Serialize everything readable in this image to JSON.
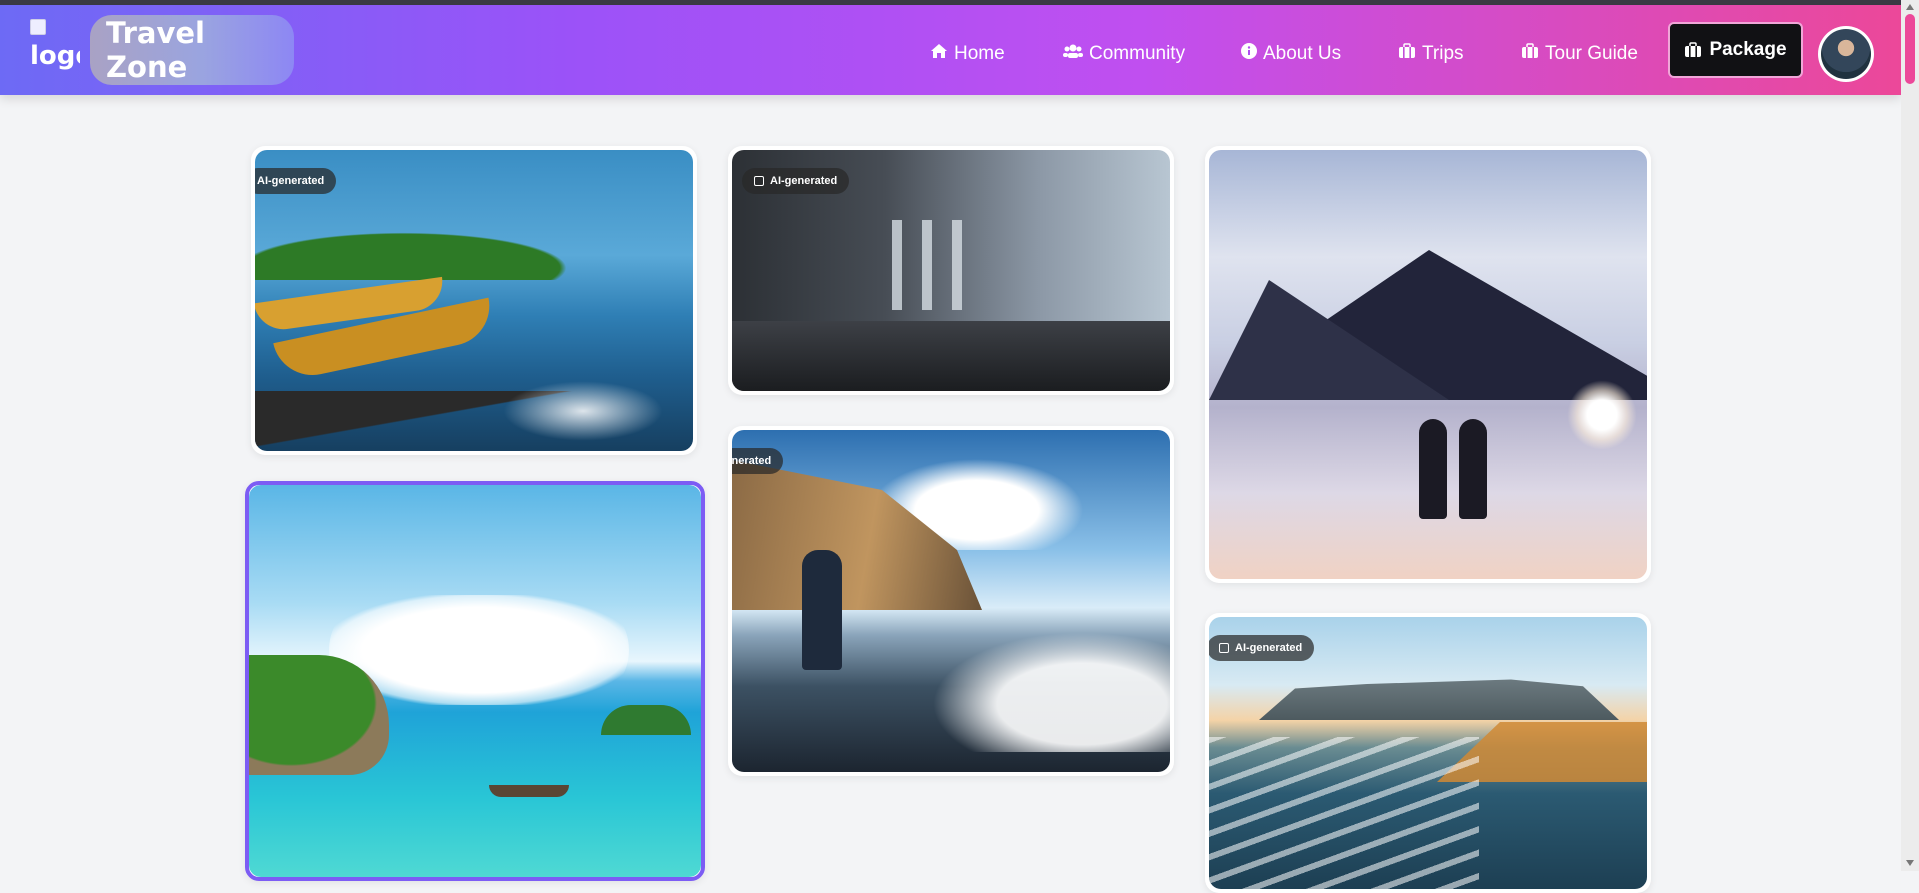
{
  "header": {
    "logo_alt": "logo",
    "brand": "Travel Zone",
    "nav": [
      {
        "label": "Home",
        "icon": "home-icon"
      },
      {
        "label": "Community",
        "icon": "users-icon"
      },
      {
        "label": "About Us",
        "icon": "info-icon"
      },
      {
        "label": "Trips",
        "icon": "suitcase-icon"
      },
      {
        "label": "Tour Guide",
        "icon": "suitcase-icon"
      }
    ],
    "package_label": "Package",
    "colors": {
      "gradient_start": "#6d6af5",
      "gradient_end": "#ec4899",
      "package_bg": "#111114"
    }
  },
  "gallery": {
    "badges": {
      "card1": "AI-generated",
      "card2": "AI-generated",
      "card4": "AI-generated",
      "card6": "AI-generated"
    },
    "selected_card_color": "#7c5cf4"
  }
}
